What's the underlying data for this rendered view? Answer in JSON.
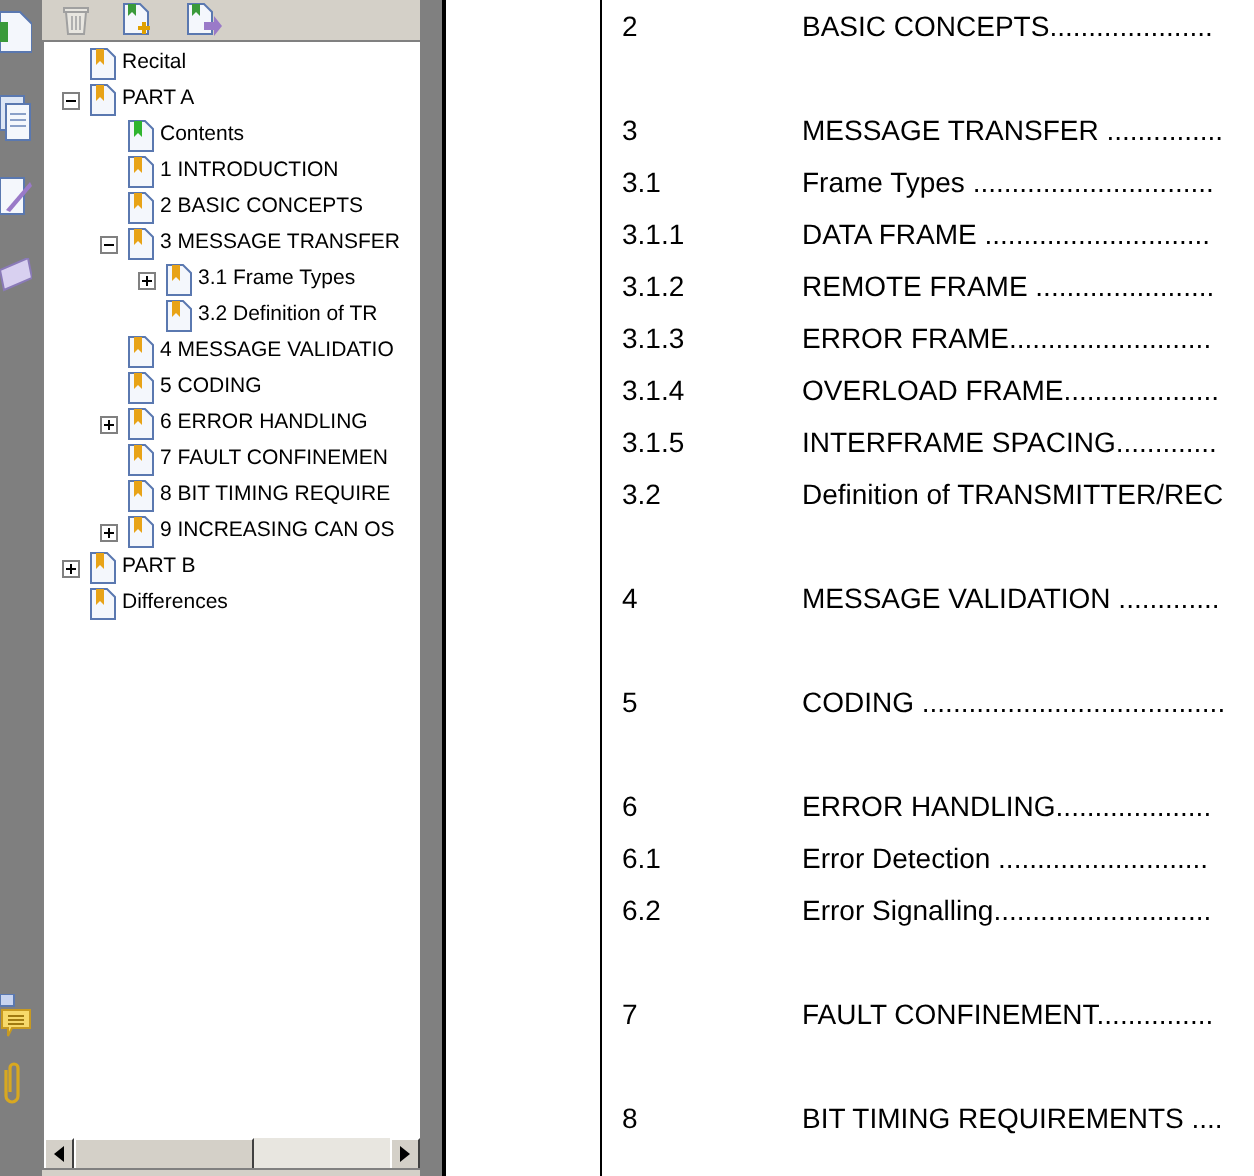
{
  "bookmarks": {
    "items": [
      {
        "label": "Recital",
        "color": "#e8a317"
      },
      {
        "label": "PART A",
        "color": "#e8a317",
        "expanded": true,
        "children": [
          {
            "label": "Contents",
            "color": "#2fb52f"
          },
          {
            "label": "1 INTRODUCTION",
            "color": "#e8a317"
          },
          {
            "label": "2 BASIC CONCEPTS",
            "color": "#e8a317"
          },
          {
            "label": "3 MESSAGE TRANSFER",
            "color": "#e8a317",
            "expanded": true,
            "children": [
              {
                "label": "3.1 Frame Types",
                "color": "#e8a317",
                "expanded": false
              },
              {
                "label": "3.2 Definition of TR",
                "color": "#e8a317"
              }
            ]
          },
          {
            "label": "4 MESSAGE VALIDATIO",
            "color": "#e8a317"
          },
          {
            "label": "5 CODING",
            "color": "#e8a317"
          },
          {
            "label": "6 ERROR HANDLING",
            "color": "#e8a317",
            "expanded": false
          },
          {
            "label": "7 FAULT CONFINEMEN",
            "color": "#e8a317"
          },
          {
            "label": "8 BIT TIMING REQUIRE",
            "color": "#e8a317"
          },
          {
            "label": "9 INCREASING CAN OS",
            "color": "#e8a317",
            "expanded": false
          }
        ]
      },
      {
        "label": "PART B",
        "color": "#e8a317",
        "expanded": false
      },
      {
        "label": "Differences",
        "color": "#e8a317"
      }
    ]
  },
  "document": {
    "toc": [
      {
        "kind": "chapter",
        "number": "2",
        "title": "BASIC CONCEPTS....................."
      },
      {
        "kind": "chapter",
        "number": "3",
        "title": "MESSAGE TRANSFER ..............."
      },
      {
        "kind": "section",
        "number": "3.1",
        "title": "Frame Types ..............................."
      },
      {
        "kind": "section",
        "number": "3.1.1",
        "title": "DATA FRAME ............................."
      },
      {
        "kind": "section",
        "number": "3.1.2",
        "title": "REMOTE FRAME ......................."
      },
      {
        "kind": "section",
        "number": "3.1.3",
        "title": "ERROR FRAME.........................."
      },
      {
        "kind": "section",
        "number": "3.1.4",
        "title": "OVERLOAD FRAME...................."
      },
      {
        "kind": "section",
        "number": "3.1.5",
        "title": "INTERFRAME SPACING............."
      },
      {
        "kind": "section",
        "number": "3.2",
        "title": "Definition of TRANSMITTER/REC"
      },
      {
        "kind": "chapter",
        "number": "4",
        "title": "MESSAGE VALIDATION ............."
      },
      {
        "kind": "chapter",
        "number": "5",
        "title": "CODING ......................................."
      },
      {
        "kind": "chapter",
        "number": "6",
        "title": "ERROR HANDLING...................."
      },
      {
        "kind": "section",
        "number": "6.1",
        "title": "Error Detection ..........................."
      },
      {
        "kind": "section",
        "number": "6.2",
        "title": "Error Signalling............................"
      },
      {
        "kind": "chapter",
        "number": "7",
        "title": "FAULT CONFINEMENT..............."
      },
      {
        "kind": "chapter",
        "number": "8",
        "title": "BIT TIMING REQUIREMENTS ...."
      }
    ]
  }
}
